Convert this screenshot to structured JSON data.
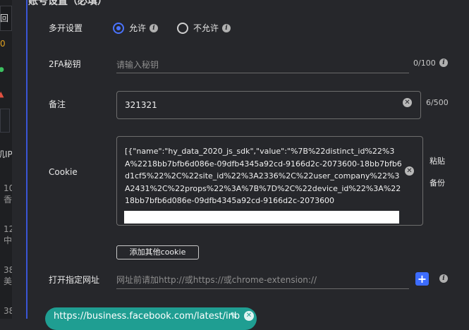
{
  "header": {
    "partial_title": "账号设置（必填）"
  },
  "sidebar": {
    "selected_char": "回",
    "items": [
      {
        "text": "0",
        "color": "#e0a020"
      },
      {
        "text": "●",
        "color": "#3cc060"
      },
      {
        "text": "▲",
        "color": "#e05040"
      }
    ],
    "section": "机IP",
    "rows": [
      {
        "num": "10",
        "sub": "香"
      },
      {
        "num": "12",
        "sub": "中"
      },
      {
        "num": "38",
        "sub": "美"
      },
      {
        "num": "38",
        "sub": ""
      }
    ]
  },
  "multi_open": {
    "label": "多开设置",
    "options": [
      {
        "text": "允许",
        "selected": true
      },
      {
        "text": "不允许",
        "selected": false
      }
    ]
  },
  "twofa": {
    "label": "2FA秘钥",
    "placeholder": "请输入秘钥",
    "count": "0/100"
  },
  "remark": {
    "label": "备注",
    "value": "321321",
    "count": "6/500"
  },
  "cookie": {
    "label": "Cookie",
    "value": "[{\"name\":\"hy_data_2020_js_sdk\",\"value\":\"%7B%22distinct_id%22%3A%2218bb7bfb6d086e-09dfb4345a92cd-9166d2c-2073600-18bb7bfb6d1cf5%22%2C%22site_id%22%3A2336%2C%22user_company%22%3A2431%2C%22props%22%3A%7B%7D%2C%22device_id%22%3A%2218bb7bfb6d086e-09dfb4345a92cd-9166d2c-2073600",
    "paste": "粘贴",
    "backup": "备份",
    "add_button": "添加其他cookie"
  },
  "open_url": {
    "label": "打开指定网址",
    "placeholder": "网址前请加http://或https://或chrome-extension://"
  },
  "url_chip": {
    "text": "https://business.facebook.com/latest/inb"
  },
  "icons": {
    "info": "info-icon",
    "clear": "clear-icon",
    "plus": "plus-icon",
    "edit": "edit-icon",
    "close": "close-icon"
  },
  "colors": {
    "accent": "#3c6cff",
    "chip": "#1f9e92",
    "background": "#26272b"
  }
}
